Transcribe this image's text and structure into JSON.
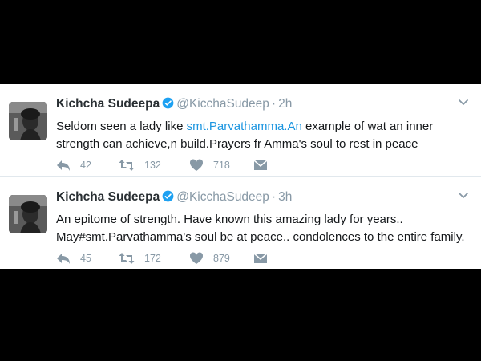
{
  "tweets": [
    {
      "display_name": "Kichcha Sudeepa",
      "handle": "@KicchaSudeep",
      "separator": "·",
      "time": "2h",
      "text_before": "Seldom seen a lady like ",
      "text_link": "smt.Parvathamma.An",
      "text_after": " example of wat an inner strength can achieve,n build.Prayers fr Amma's soul to rest in peace",
      "replies": "42",
      "retweets": "132",
      "likes": "718"
    },
    {
      "display_name": "Kichcha Sudeepa",
      "handle": "@KicchaSudeep",
      "separator": "·",
      "time": "3h",
      "text": "An epitome of strength. Have known this amazing lady for years.. May#smt.Parvathamma's soul be at peace.. condolences to the entire family.",
      "replies": "45",
      "retweets": "172",
      "likes": "879"
    }
  ],
  "icons": {
    "avatar": "profile-photo",
    "verified": "verified-badge-icon",
    "reply": "reply-icon",
    "retweet": "retweet-icon",
    "like": "heart-icon",
    "dm": "envelope-icon",
    "menu": "chevron-down-icon"
  },
  "colors": {
    "verified": "#1da1f2",
    "link": "#1b95e0",
    "muted": "#8899a6",
    "text": "#14171a"
  }
}
